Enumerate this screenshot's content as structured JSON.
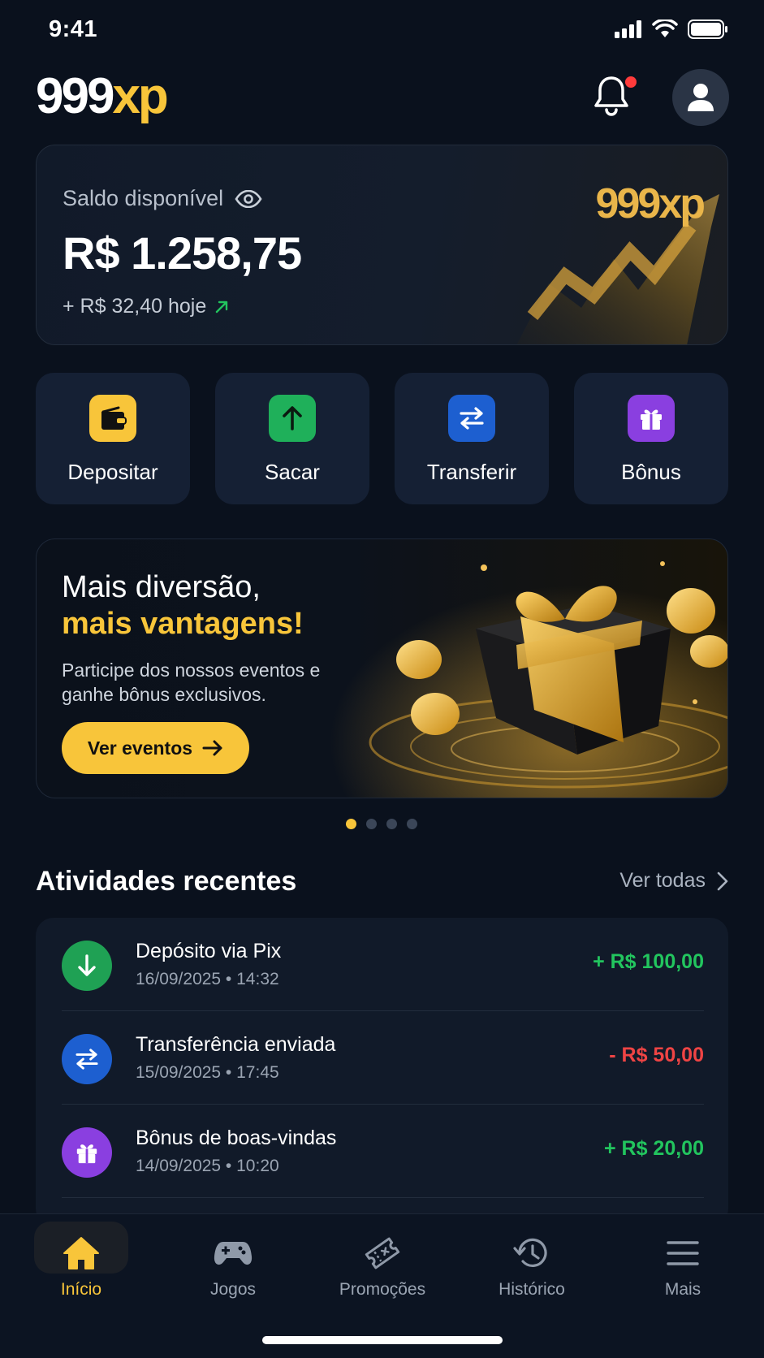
{
  "status_bar": {
    "time": "9:41"
  },
  "header": {
    "logo_main": "999",
    "logo_accent": "xp"
  },
  "balance": {
    "label": "Saldo disponível",
    "value": "R$ 1.258,75",
    "today": "+ R$ 32,40 hoje",
    "brand_main": "999",
    "brand_accent": "xp"
  },
  "quick_actions": [
    {
      "label": "Depositar",
      "icon": "wallet-icon",
      "color": "#f8c53a"
    },
    {
      "label": "Sacar",
      "icon": "arrow-up-icon",
      "color": "#1fb05a"
    },
    {
      "label": "Transferir",
      "icon": "transfer-icon",
      "color": "#1d5fd0"
    },
    {
      "label": "Bônus",
      "icon": "gift-icon",
      "color": "#8a3fe0"
    }
  ],
  "promo": {
    "title_line1": "Mais diversão,",
    "title_line2": "mais vantagens!",
    "description": "Participe dos nossos eventos e ganhe bônus exclusivos.",
    "button_label": "Ver eventos",
    "carousel_total": 4,
    "carousel_active": 1
  },
  "recent": {
    "title": "Atividades recentes",
    "see_all": "Ver todas",
    "items": [
      {
        "title": "Depósito via Pix",
        "date": "16/09/2025 • 14:32",
        "amount": "+ R$ 100,00",
        "icon": "arrow-down-icon",
        "icon_color": "#1fa154",
        "amount_color": "#22c55e"
      },
      {
        "title": "Transferência enviada",
        "date": "15/09/2025 • 17:45",
        "amount": "- R$ 50,00",
        "icon": "transfer-icon",
        "icon_color": "#1d5fd0",
        "amount_color": "#ef4444"
      },
      {
        "title": "Bônus de boas-vindas",
        "date": "14/09/2025 • 10:20",
        "amount": "+ R$ 20,00",
        "icon": "gift-icon",
        "icon_color": "#8a3fe0",
        "amount_color": "#22c55e"
      }
    ]
  },
  "bottom_nav": [
    {
      "label": "Início",
      "icon": "home-icon",
      "active": true
    },
    {
      "label": "Jogos",
      "icon": "gamepad-icon",
      "active": false
    },
    {
      "label": "Promoções",
      "icon": "ticket-icon",
      "active": false
    },
    {
      "label": "Histórico",
      "icon": "history-icon",
      "active": false
    },
    {
      "label": "Mais",
      "icon": "menu-icon",
      "active": false
    }
  ],
  "colors": {
    "background": "#0a111d",
    "accent": "#f8c53a",
    "positive": "#22c55e",
    "negative": "#ef4444"
  }
}
